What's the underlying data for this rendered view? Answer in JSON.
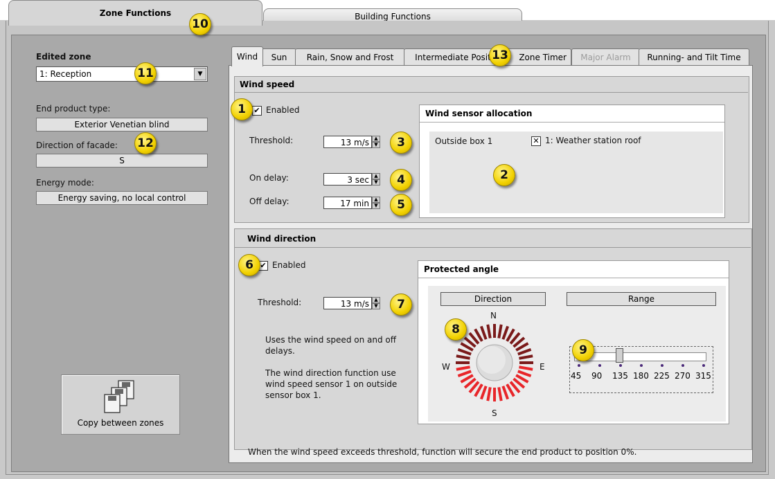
{
  "tabs": {
    "zone": "Zone Functions",
    "building": "Building Functions"
  },
  "left": {
    "edited_zone_label": "Edited zone",
    "edited_zone_value": "1: Reception",
    "end_product_label": "End product type:",
    "end_product_value": "Exterior Venetian blind",
    "facade_label": "Direction of facade:",
    "facade_value": "S",
    "energy_label": "Energy mode:",
    "energy_value": "Energy saving, no local control",
    "copy_label": "Copy between zones"
  },
  "subtabs": [
    "Wind",
    "Sun",
    "Rain, Snow and Frost",
    "Intermediate Posit",
    "Zone Timer",
    "Major Alarm",
    "Running- and Tilt Time"
  ],
  "wind_speed": {
    "title": "Wind speed",
    "enabled_label": "Enabled",
    "enabled": true,
    "threshold_label": "Threshold:",
    "threshold_value": "13 m/s",
    "on_delay_label": "On delay:",
    "on_delay_value": "3 sec",
    "off_delay_label": "Off delay:",
    "off_delay_value": "17 min"
  },
  "sensor_alloc": {
    "title": "Wind sensor allocation",
    "box_label": "Outside box 1",
    "sensor_label": "1: Weather station roof",
    "checked": true
  },
  "wind_direction": {
    "title": "Wind direction",
    "enabled_label": "Enabled",
    "enabled": true,
    "threshold_label": "Threshold:",
    "threshold_value": "13 m/s",
    "note1": "Uses the wind speed on and off delays.",
    "note2": "The wind direction function use wind speed sensor 1 on outside sensor box 1."
  },
  "protected_angle": {
    "title": "Protected angle",
    "direction_label": "Direction",
    "range_label": "Range",
    "compass": {
      "n": "N",
      "e": "E",
      "s": "S",
      "w": "W"
    },
    "range_ticks": [
      "45",
      "90",
      "135",
      "180",
      "225",
      "270",
      "315"
    ],
    "range_selected": "135"
  },
  "footer": "When the wind speed exceeds threshold, function will secure the end product to position 0%.",
  "badges": [
    "1",
    "2",
    "3",
    "4",
    "5",
    "6",
    "7",
    "8",
    "9",
    "10",
    "11",
    "12",
    "13"
  ],
  "colors": {
    "badge": "#f2d100",
    "compass_active": "#e8262a",
    "compass_dim": "#7a1a1a"
  }
}
